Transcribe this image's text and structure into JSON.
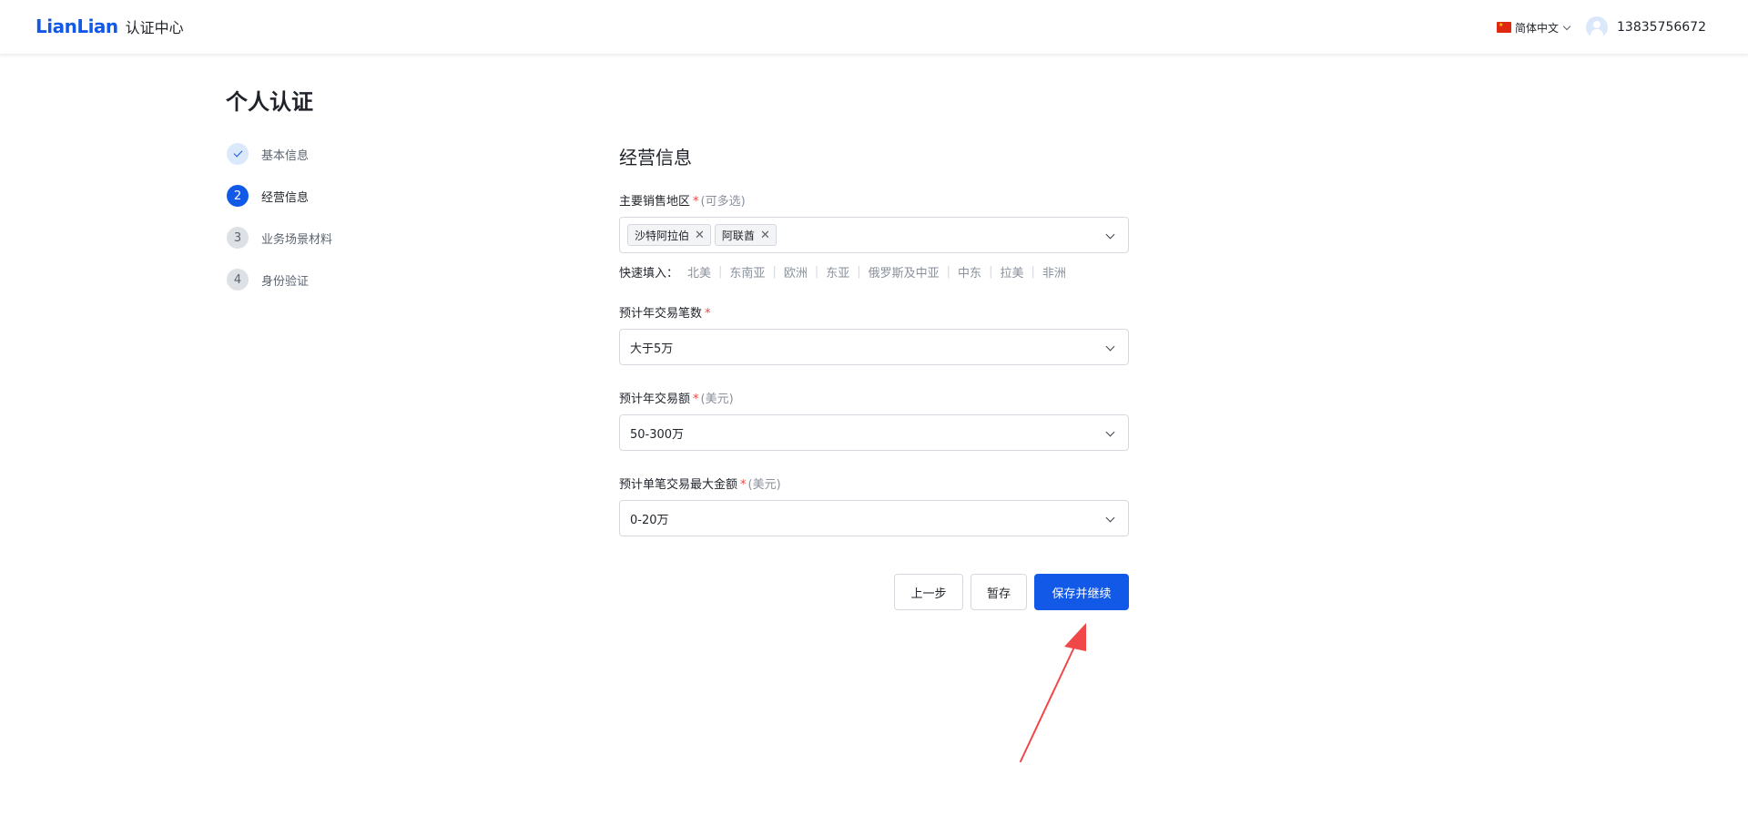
{
  "header": {
    "brand": "LianLian",
    "brand_sub": "认证中心",
    "language": "简体中文",
    "language_flag": "china-flag-icon",
    "phone": "13835756672"
  },
  "page_title": "个人认证",
  "steps": [
    {
      "number": "",
      "label": "基本信息",
      "status": "done"
    },
    {
      "number": "2",
      "label": "经营信息",
      "status": "active"
    },
    {
      "number": "3",
      "label": "业务场景材料",
      "status": "todo"
    },
    {
      "number": "4",
      "label": "身份验证",
      "status": "todo"
    }
  ],
  "section_title": "经营信息",
  "fields": {
    "regions": {
      "label": "主要销售地区",
      "required_mark": "*",
      "hint": "(可多选)",
      "tags": [
        "沙特阿拉伯",
        "阿联酋"
      ]
    },
    "quick_fill": {
      "label": "快速填入：",
      "options": [
        "北美",
        "东南亚",
        "欧洲",
        "东亚",
        "俄罗斯及中亚",
        "中东",
        "拉美",
        "非洲"
      ],
      "separator": "|"
    },
    "annual_count": {
      "label": "预计年交易笔数",
      "required_mark": "*",
      "value": "大于5万"
    },
    "annual_amount": {
      "label": "预计年交易额",
      "required_mark": "*",
      "hint": "(美元)",
      "value": "50-300万"
    },
    "max_single": {
      "label": "预计单笔交易最大金额",
      "required_mark": "*",
      "hint": "(美元)",
      "value": "0-20万"
    }
  },
  "buttons": {
    "prev": "上一步",
    "save_draft": "暂存",
    "save_continue": "保存并继续"
  },
  "colors": {
    "primary": "#1259e8",
    "required": "#f0463c",
    "annotation_arrow": "#f04848"
  }
}
